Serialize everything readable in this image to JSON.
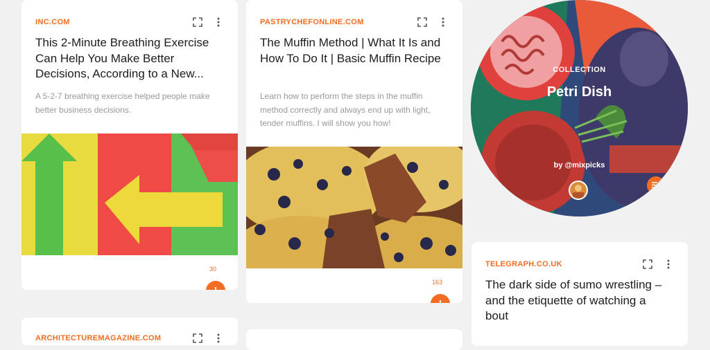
{
  "cards": [
    {
      "source": "INC.COM",
      "title": "This 2-Minute Breathing Exercise Can Help You Make Better Decisions, According to a New...",
      "description": "A 5-2-7 breathing exercise helped people make better business decisions.",
      "count": "30",
      "image": "colorful-paper-arrows"
    },
    {
      "source": "PASTRYCHEFONLINE.COM",
      "title": "The Muffin Method | What It Is and How To Do It | Basic Muffin Recipe",
      "description": "Learn how to perform the steps in the muffin method correctly and always end up with light, tender muffins. I will show you how!",
      "count": "163",
      "image": "blueberry-muffins"
    },
    {
      "source": "TELEGRAPH.CO.UK",
      "title": "The dark side of sumo wrestling – and the etiquette of watching a bout"
    },
    {
      "source": "ARCHITECTUREMAGAZINE.COM"
    }
  ],
  "collection": {
    "kicker": "COLLECTION",
    "title": "Petri Dish",
    "byline": "by @mixpicks"
  },
  "colors": {
    "accent": "#f26d21",
    "background": "#f1f1f1",
    "card": "#ffffff"
  },
  "icons": [
    "expand-icon",
    "more-vertical-icon",
    "plus-icon",
    "add-to-playlist-icon",
    "avatar"
  ]
}
